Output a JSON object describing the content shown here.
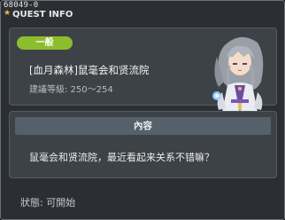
{
  "window": {
    "quest_id": "68049-0",
    "title": "QUEST INFO"
  },
  "quest": {
    "category_badge": "一般",
    "name": "[血月森林]鼠毫会和贤流院",
    "level_requirement": "建議等級: 250～254",
    "npc_portrait": "silver-haired-npc-portrait"
  },
  "content": {
    "header": "內容",
    "text": "鼠毫会和贤流院，最近看起来关系不错嘛？"
  },
  "status": {
    "text": "狀態: 可開始"
  },
  "colors": {
    "badge": "#8cbd2d",
    "panel": "#3d4246",
    "background": "#2b2f33",
    "header_bar": "#56606a"
  }
}
